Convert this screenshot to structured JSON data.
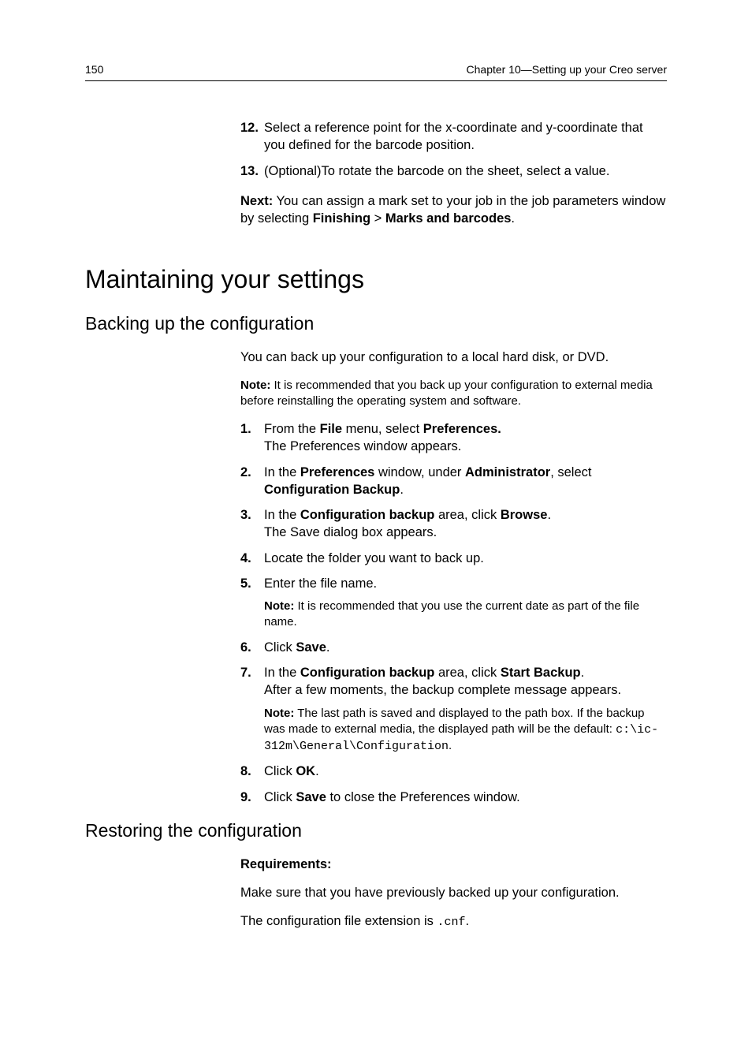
{
  "header": {
    "page_number": "150",
    "chapter": "Chapter 10—Setting up your Creo server"
  },
  "intro_steps": {
    "s12": {
      "num": "12.",
      "text": "Select a reference point for the x-coordinate and y-coordinate that you defined for the barcode position."
    },
    "s13": {
      "num": "13.",
      "text": "(Optional)To rotate the barcode on the sheet, select a value."
    }
  },
  "next": {
    "label": "Next:",
    "t1": " You can assign a mark set to your job in the job parameters window by selecting ",
    "b1": "Finishing",
    "sep": " > ",
    "b2": "Marks and barcodes",
    "tail": "."
  },
  "h1": "Maintaining your settings",
  "backup": {
    "heading": "Backing up the configuration",
    "intro": "You can back up your configuration to a local hard disk, or DVD.",
    "note_label": "Note:",
    "note_text": " It is recommended that you back up your configuration to external media before reinstalling the operating system and software.",
    "steps": {
      "s1": {
        "num": "1.",
        "t1": "From the ",
        "b1": "File",
        "t2": " menu, select ",
        "b2": "Preferences.",
        "line2": "The Preferences window appears."
      },
      "s2": {
        "num": "2.",
        "t1": "In the ",
        "b1": "Preferences",
        "t2": " window, under ",
        "b2": "Administrator",
        "t3": ", select ",
        "b3": "Configuration Backup",
        "tail": "."
      },
      "s3": {
        "num": "3.",
        "t1": "In the ",
        "b1": "Configuration backup",
        "t2": " area, click ",
        "b2": "Browse",
        "tail": ".",
        "line2": "The Save dialog box appears."
      },
      "s4": {
        "num": "4.",
        "text": "Locate the folder you want to back up."
      },
      "s5": {
        "num": "5.",
        "text": "Enter the file name.",
        "note_label": "Note:",
        "note_text": " It is recommended that you use the current date as part of the file name."
      },
      "s6": {
        "num": "6.",
        "t1": "Click ",
        "b1": "Save",
        "tail": "."
      },
      "s7": {
        "num": "7.",
        "t1": "In the ",
        "b1": "Configuration backup",
        "t2": " area, click ",
        "b2": "Start Backup",
        "tail": ".",
        "line2": "After a few moments, the backup complete message appears.",
        "note_label": "Note:",
        "note_t1": " The last path is saved and displayed to the path box. If the backup was made to external media, the displayed path will be the default: ",
        "note_code": "c:\\ic-312m\\General\\Configuration",
        "note_tail": "."
      },
      "s8": {
        "num": "8.",
        "t1": "Click ",
        "b1": "OK",
        "tail": "."
      },
      "s9": {
        "num": "9.",
        "t1": "Click ",
        "b1": "Save",
        "t2": " to close the Preferences window."
      }
    }
  },
  "restore": {
    "heading": "Restoring the configuration",
    "req_label": "Requirements:",
    "req_text": "Make sure that you have previously backed up your configuration.",
    "ext_t1": "The configuration file extension is ",
    "ext_code": ".cnf",
    "ext_tail": "."
  }
}
